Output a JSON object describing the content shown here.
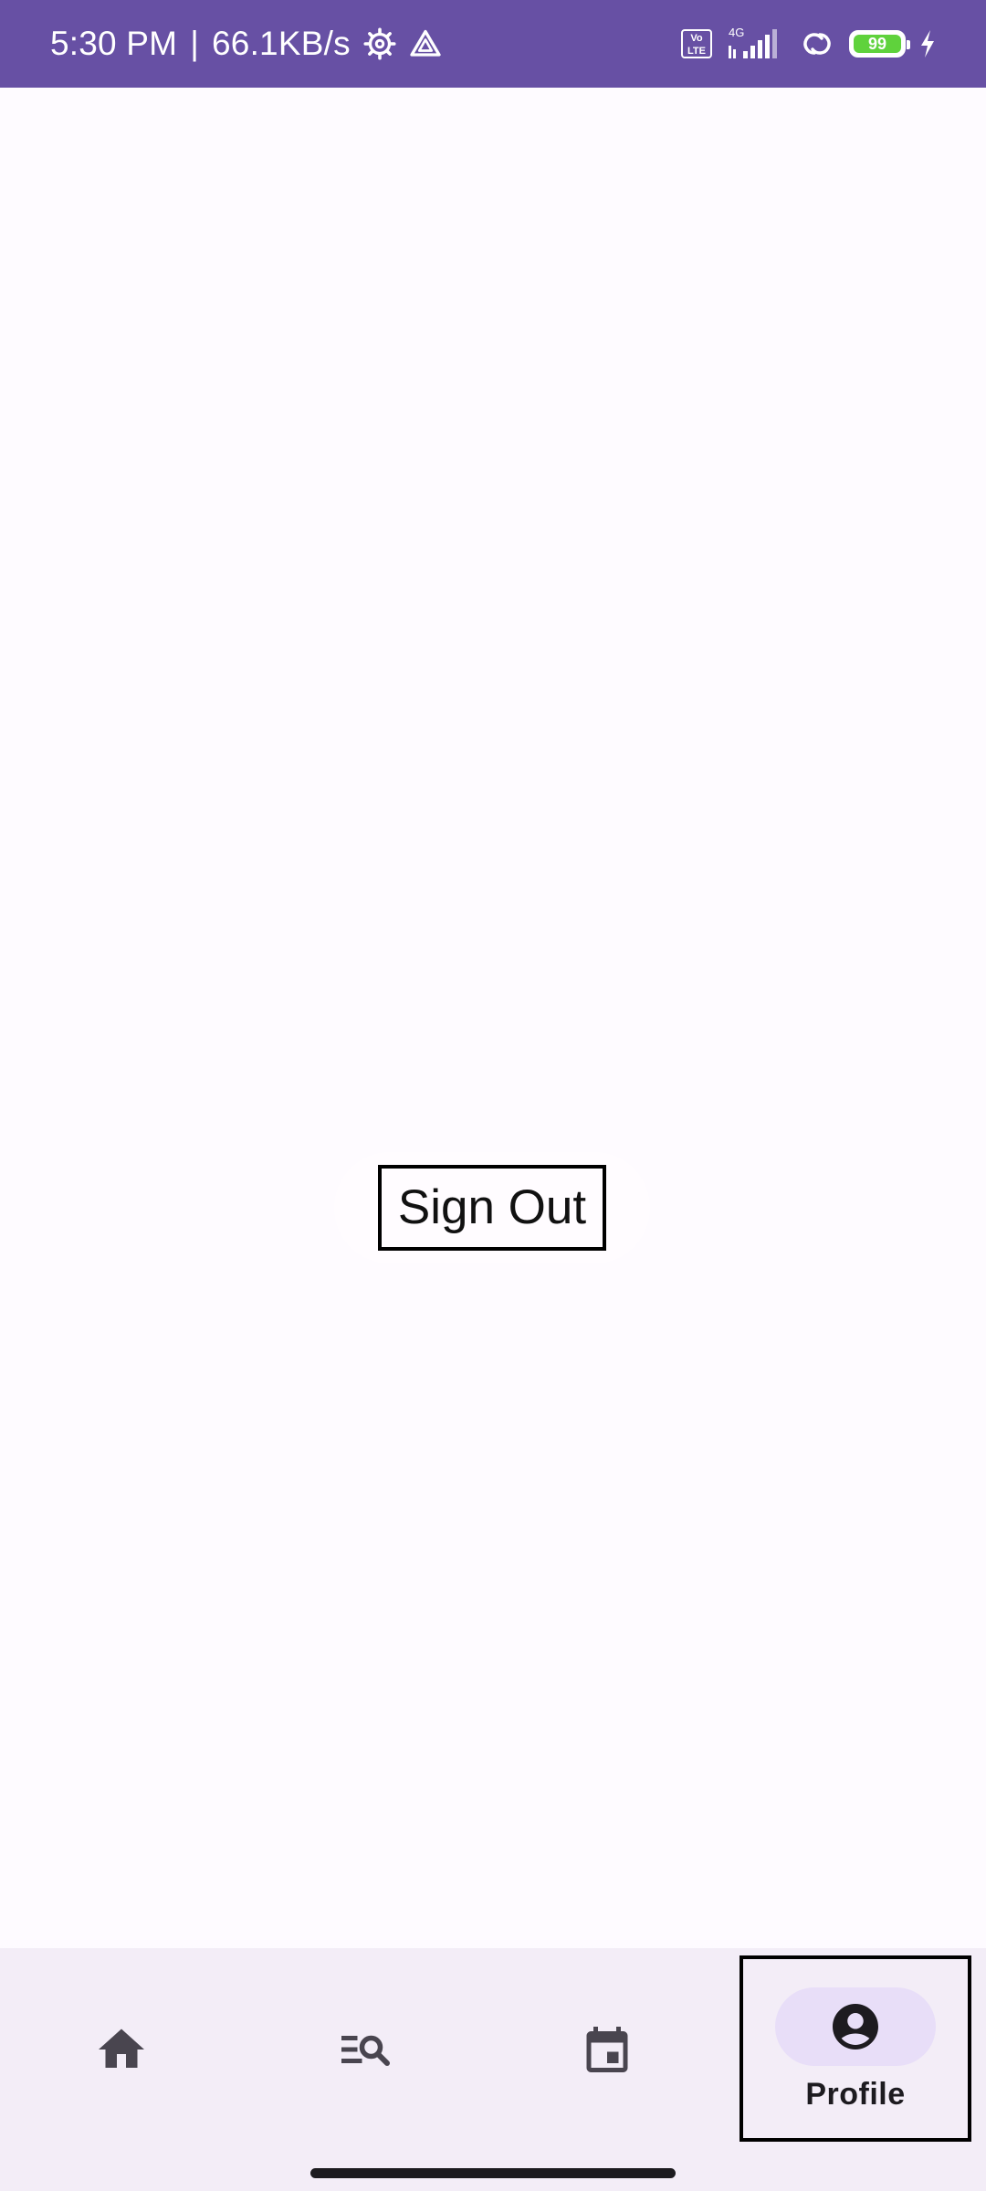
{
  "status_bar": {
    "time": "5:30 PM",
    "separator": "|",
    "network_speed": "66.1KB/s",
    "volte_label": "Vo LTE",
    "network_type": "4G",
    "battery_level": "99",
    "background_color": "#6750a4",
    "icons": [
      "settings-cog-icon",
      "drive-triangle-icon",
      "volte-icon",
      "signal-icon",
      "link-icon",
      "battery-icon",
      "charging-bolt-icon"
    ]
  },
  "main": {
    "sign_out_label": "Sign Out"
  },
  "bottom_nav": {
    "background_color": "#f3edf7",
    "indicator_color": "#e8def8",
    "items": [
      {
        "id": "home",
        "icon": "home-icon",
        "label": "",
        "selected": false
      },
      {
        "id": "search",
        "icon": "list-search-icon",
        "label": "",
        "selected": false
      },
      {
        "id": "calendar",
        "icon": "calendar-icon",
        "label": "",
        "selected": false
      },
      {
        "id": "profile",
        "icon": "account-circle-icon",
        "label": "Profile",
        "selected": true
      }
    ]
  }
}
